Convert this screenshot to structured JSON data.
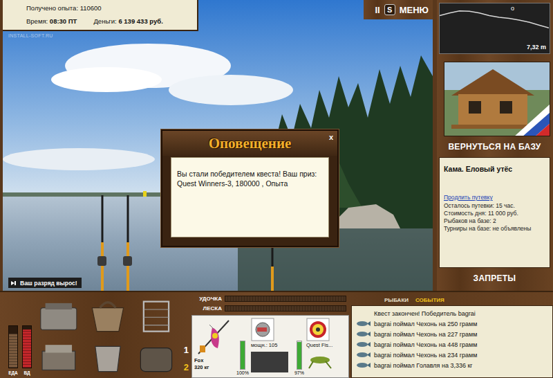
{
  "stats": {
    "experience": "Получено опыта: 110600",
    "time_label": "Время:",
    "time": "08:30 ПТ",
    "money_label": "Деньги:",
    "money": "6 139 433 руб."
  },
  "watermark": "INSTALL-SOFT.RU",
  "top_controls": {
    "pause": "II",
    "sound": "S",
    "menu": "МЕНЮ"
  },
  "depth": {
    "reading": "7,32 m",
    "marker": "o",
    "profile": [
      2.6,
      1.9,
      1.3,
      1.4,
      1.9,
      2.6,
      3.1,
      3.4,
      3.9,
      4.5,
      5.3,
      6.1
    ]
  },
  "rank_badge": "Ваш разряд вырос!",
  "notification": {
    "title": "Оповещение",
    "close": "x",
    "message": "Вы стали победителем квеста! Ваш приз: Quest Winners-3, 180000 , Опыта"
  },
  "base_button": "ВЕРНУТЬСЯ НА БАЗУ",
  "location": {
    "title": "Кама. Еловый утёс",
    "link": "Продлить путевку",
    "lines": [
      "Осталось путевки: 15 час.",
      "Стоимость дня: 11 000 руб.",
      "Рыбаков на базе: 2",
      "Турниры на базе: не объявлены"
    ]
  },
  "bans_button": "ЗАПРЕТЫ",
  "meters": [
    {
      "label": "ЕДА",
      "level": 0.82,
      "color": "#7a5a3e"
    },
    {
      "label": "ВД",
      "level": 0.92,
      "color": "#c4262a"
    }
  ],
  "slot_nav": [
    {
      "label": "1",
      "selected": false
    },
    {
      "label": "2",
      "selected": true
    }
  ],
  "tension": [
    {
      "label": "УДОЧКА",
      "level": 0
    },
    {
      "label": "ЛЕСКА",
      "level": 0
    }
  ],
  "tackle": {
    "rod": {
      "name": "Fox",
      "load": "320 кг",
      "condition": "100%",
      "level": 1
    },
    "reel": {
      "power": "мощн.: 105",
      "condition": "97%",
      "level": 0.97
    },
    "lure": {
      "name": "Quest Fis..."
    }
  },
  "log_tabs": [
    {
      "label": "РЫБАКИ",
      "selected": false
    },
    {
      "label": "СОБЫТИЯ",
      "selected": true
    }
  ],
  "events": [
    {
      "text": "Квест закончен! Победитель bagrai",
      "kind": "notice"
    },
    {
      "text": "bagrai поймал Чехонь на 250 грамм",
      "kind": "catch"
    },
    {
      "text": "bagrai поймал Чехонь на 227 грамм",
      "kind": "catch"
    },
    {
      "text": "bagrai поймал Чехонь на 448 грамм",
      "kind": "catch"
    },
    {
      "text": "bagrai поймал Чехонь на 234 грамм",
      "kind": "catch"
    },
    {
      "text": "bagrai поймал Голавля на 3,336 кг",
      "kind": "catch"
    }
  ]
}
